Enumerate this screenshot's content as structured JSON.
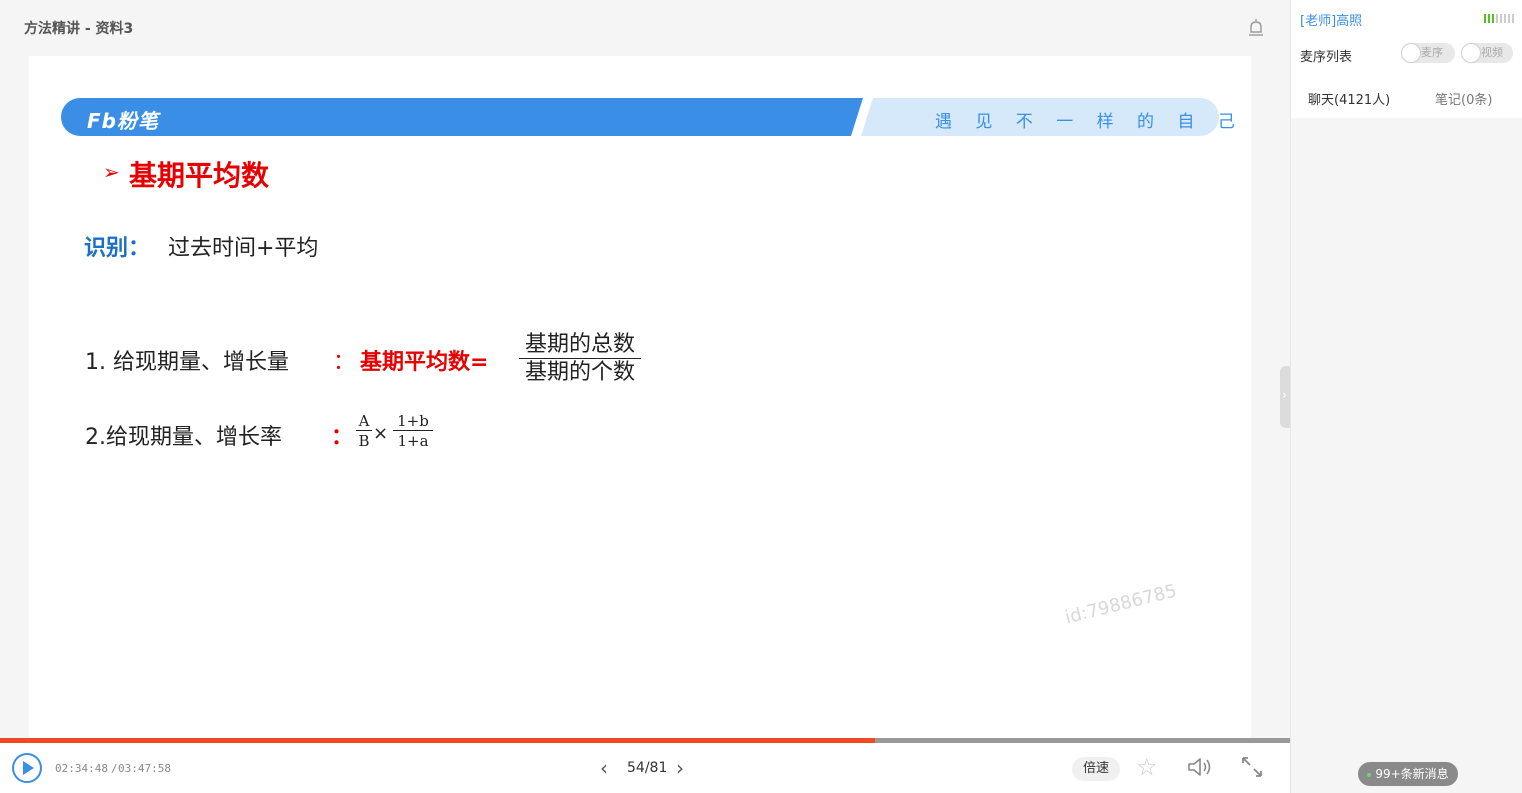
{
  "header": {
    "course_title": "方法精讲 - 资料3",
    "alert_icon": "alert-bell-icon"
  },
  "slide": {
    "brand": "Fb粉笔",
    "slogan": "遇 见 不 一 样 的 自 己",
    "heading_marker": "➢",
    "heading": "基期平均数",
    "identify_label": "识别：",
    "identify_text": "过去时间+平均",
    "line1_text": "1. 给现期量、增长量",
    "line1_colon": "：",
    "line1_formula_label": "基期平均数=",
    "line1_numerator": "基期的总数",
    "line1_denominator": "基期的个数",
    "line2_text": "2.给现期量、增长率",
    "line2_colon": "：",
    "frac2_num": "A",
    "frac2_den": "B",
    "times_sign": "×",
    "frac3_num": "1+b",
    "frac3_den": "1+a",
    "watermark": "id:79886785"
  },
  "player": {
    "progress": 0.678,
    "time_current": "02:34:48",
    "time_separator": "/",
    "time_total": "03:47:58",
    "prev_label": "‹",
    "page_indicator": "54/81",
    "next_label": "›",
    "speed_label": "倍速",
    "collapse_label": "›",
    "icons": [
      "play-icon",
      "star-icon",
      "volume-icon",
      "fullscreen-icon"
    ]
  },
  "sidebar": {
    "teacher_name": "[老师]高照",
    "queue_title": "麦序列表",
    "toggle_queue_label": "麦序",
    "toggle_video_label": "视频",
    "tab_chat": "聊天(4121人)",
    "tab_notes": "笔记(0条)",
    "new_messages": "99+条新消息"
  },
  "colors": {
    "accent_blue": "#3a8ee6",
    "highlight_red": "#e60000",
    "progress_orange": "#ee4a23"
  }
}
